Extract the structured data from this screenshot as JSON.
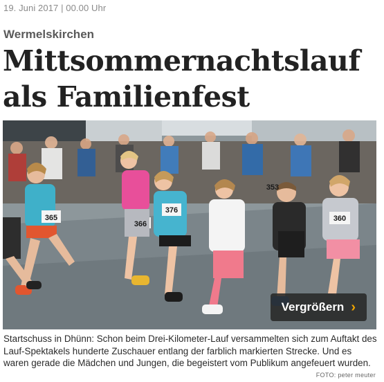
{
  "article": {
    "dateline": "19. Juni 2017 | 00.00 Uhr",
    "kicker": "Wermelskirchen",
    "headline": "Mittsommernachtslauf als Familienfest",
    "image": {
      "button_label": "Vergrößern",
      "button_icon": "chevron-right-icon",
      "bib_numbers": [
        "365",
        "366",
        "376",
        "353",
        "360"
      ]
    },
    "caption": "Startschuss in Dhünn: Schon beim Drei-Kilometer-Lauf versammelten sich zum Auftakt des Lauf-Spektakels hunderte Zuschauer entlang der farblich markierten Strecke. Und es waren gerade die Mädchen und Jungen, die begeistert vom Publikum angefeuert wurden.",
    "photo_credit": "FOTO: peter meuter"
  },
  "colors": {
    "accent": "#f0a500",
    "headline": "#222222",
    "dateline": "#8a8a8a"
  }
}
